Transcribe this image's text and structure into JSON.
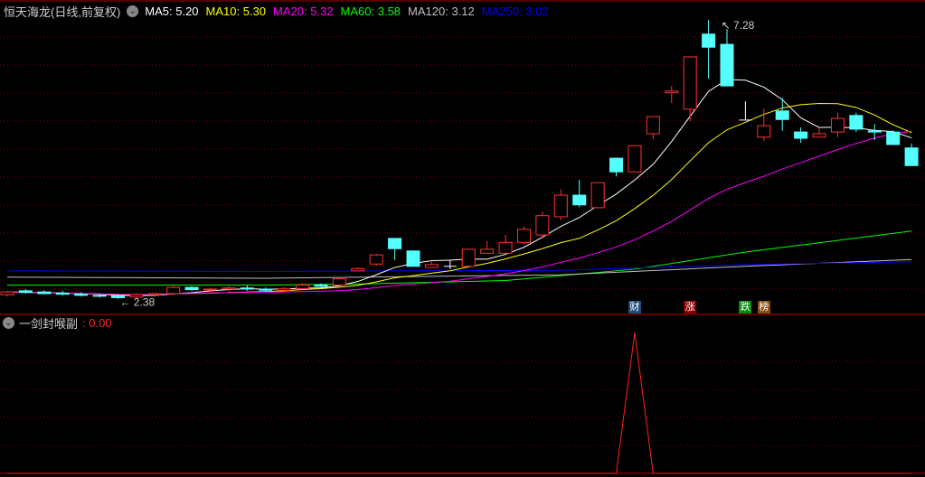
{
  "header": {
    "title": "恒天海龙(日线,前复权)",
    "ma": [
      {
        "label": "MA5: 5.20",
        "color": "#ffffff"
      },
      {
        "label": "MA10: 5.30",
        "color": "#ffff00"
      },
      {
        "label": "MA20: 5.32",
        "color": "#ff00ff"
      },
      {
        "label": "MA60: 3.58",
        "color": "#00ff00"
      },
      {
        "label": "MA120: 3.12",
        "color": "#c0c0c0"
      },
      {
        "label": "MA250: 3.02",
        "color": "#0000ff"
      }
    ]
  },
  "indicator": {
    "name": "一剑封喉副",
    "value": ": 0.00"
  },
  "tags": [
    {
      "text": "财",
      "bg": "#1f4a7a",
      "index": 34
    },
    {
      "text": "涨",
      "bg": "#8a0000",
      "index": 37
    },
    {
      "text": "跌",
      "bg": "#0a8a0a",
      "index": 40
    },
    {
      "text": "榜",
      "bg": "#8a4a10",
      "index": 41
    }
  ],
  "chart_data": {
    "type": "candlestick",
    "high_label": "7.28",
    "low_label": "2.38",
    "ohlc": [
      [
        2.45,
        2.52,
        2.42,
        2.5
      ],
      [
        2.52,
        2.55,
        2.47,
        2.49
      ],
      [
        2.5,
        2.53,
        2.46,
        2.47
      ],
      [
        2.48,
        2.52,
        2.44,
        2.46
      ],
      [
        2.46,
        2.49,
        2.42,
        2.44
      ],
      [
        2.44,
        2.47,
        2.4,
        2.43
      ],
      [
        2.43,
        2.46,
        2.38,
        2.4
      ],
      [
        2.41,
        2.47,
        2.39,
        2.45
      ],
      [
        2.45,
        2.48,
        2.43,
        2.47
      ],
      [
        2.47,
        2.6,
        2.45,
        2.58
      ],
      [
        2.58,
        2.6,
        2.52,
        2.54
      ],
      [
        2.54,
        2.57,
        2.5,
        2.55
      ],
      [
        2.55,
        2.6,
        2.5,
        2.57
      ],
      [
        2.57,
        2.62,
        2.52,
        2.55
      ],
      [
        2.55,
        2.58,
        2.5,
        2.53
      ],
      [
        2.53,
        2.58,
        2.5,
        2.56
      ],
      [
        2.56,
        2.65,
        2.54,
        2.62
      ],
      [
        2.62,
        2.65,
        2.58,
        2.6
      ],
      [
        2.62,
        2.75,
        2.6,
        2.73
      ],
      [
        2.87,
        2.93,
        2.86,
        2.91
      ],
      [
        2.99,
        3.17,
        2.96,
        3.15
      ],
      [
        3.44,
        3.44,
        3.06,
        3.26
      ],
      [
        3.22,
        3.22,
        2.95,
        2.95
      ],
      [
        2.93,
        3.03,
        2.93,
        2.98
      ],
      [
        2.95,
        3.06,
        2.9,
        2.95
      ],
      [
        2.95,
        3.25,
        2.95,
        3.25
      ],
      [
        3.18,
        3.39,
        3.18,
        3.25
      ],
      [
        3.18,
        3.5,
        3.17,
        3.37
      ],
      [
        3.37,
        3.65,
        3.33,
        3.6
      ],
      [
        3.5,
        3.91,
        3.44,
        3.84
      ],
      [
        3.82,
        4.3,
        3.76,
        4.2
      ],
      [
        4.2,
        4.47,
        3.99,
        4.03
      ],
      [
        3.98,
        4.42,
        3.98,
        4.42
      ],
      [
        4.85,
        4.85,
        4.53,
        4.61
      ],
      [
        4.61,
        5.07,
        4.61,
        5.07
      ],
      [
        5.28,
        5.58,
        5.18,
        5.58
      ],
      [
        6.0,
        6.12,
        5.82,
        6.03
      ],
      [
        5.71,
        6.63,
        5.5,
        6.63
      ],
      [
        7.03,
        7.28,
        6.25,
        6.8
      ],
      [
        6.85,
        7.12,
        6.12,
        6.12
      ],
      [
        5.52,
        5.85,
        5.52,
        5.52
      ],
      [
        5.22,
        5.72,
        5.15,
        5.42
      ],
      [
        5.68,
        5.91,
        5.33,
        5.53
      ],
      [
        5.31,
        5.39,
        5.12,
        5.2
      ],
      [
        5.22,
        5.39,
        5.22,
        5.28
      ],
      [
        5.31,
        5.65,
        5.22,
        5.55
      ],
      [
        5.6,
        5.65,
        5.31,
        5.36
      ],
      [
        5.33,
        5.45,
        5.17,
        5.31
      ],
      [
        5.31,
        5.34,
        5.09,
        5.09
      ],
      [
        5.03,
        5.11,
        4.72,
        4.72
      ]
    ],
    "long_ma": {
      "MA60": [
        [
          0,
          2.62
        ],
        [
          14,
          2.62
        ],
        [
          19,
          2.64
        ],
        [
          27,
          2.7
        ],
        [
          34,
          2.9
        ],
        [
          40,
          3.2
        ],
        [
          49,
          3.57
        ]
      ],
      "MA120": [
        [
          0,
          2.76
        ],
        [
          14,
          2.74
        ],
        [
          30,
          2.8
        ],
        [
          40,
          2.95
        ],
        [
          49,
          3.07
        ]
      ],
      "MA250": [
        [
          0,
          2.87
        ],
        [
          14,
          2.86
        ],
        [
          30,
          2.88
        ],
        [
          40,
          2.98
        ],
        [
          49,
          3.03
        ]
      ]
    },
    "indicator_values": [
      0,
      0,
      0,
      0,
      0,
      0,
      0,
      0,
      0,
      0,
      0,
      0,
      0,
      0,
      0,
      0,
      0,
      0,
      0,
      0,
      0,
      0,
      0,
      0,
      0,
      0,
      0,
      0,
      0,
      0,
      0,
      0,
      0,
      0,
      1,
      0,
      0,
      0,
      0,
      0,
      0,
      0,
      0,
      0,
      0,
      0,
      0,
      0,
      0,
      0
    ],
    "ylim": [
      2.3,
      7.3
    ]
  }
}
